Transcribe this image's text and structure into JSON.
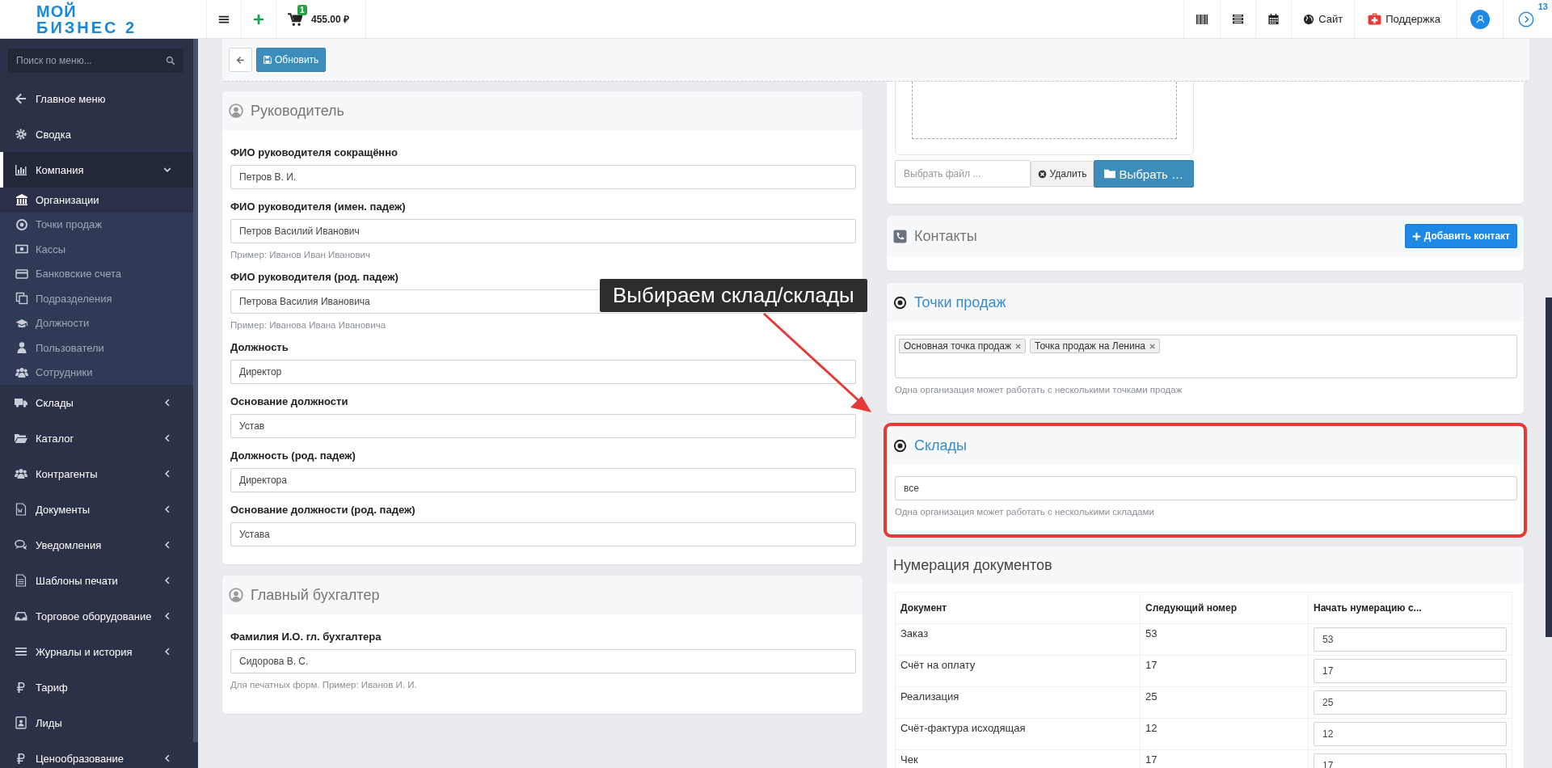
{
  "logo": {
    "line1": "МОЙ",
    "line2": "БИЗНЕС 2"
  },
  "topbar": {
    "cart_badge": "1",
    "cart_total": "455.00 ₽",
    "site": "Сайт",
    "support": "Поддержка",
    "notifications_badge": "13"
  },
  "sidebar": {
    "search_placeholder": "Поиск по меню...",
    "items": [
      {
        "kind": "link",
        "label": "Главное меню",
        "selected": false
      },
      {
        "kind": "link",
        "label": "Сводка",
        "selected": false
      },
      {
        "kind": "group",
        "label": "Компания",
        "selected": true,
        "expanded": true,
        "children": [
          {
            "label": "Организации",
            "selected": true
          },
          {
            "label": "Точки продаж",
            "selected": false
          },
          {
            "label": "Кассы",
            "selected": false
          },
          {
            "label": "Банковские счета",
            "selected": false
          },
          {
            "label": "Подразделения",
            "selected": false
          },
          {
            "label": "Должности",
            "selected": false
          },
          {
            "label": "Пользователи",
            "selected": false
          },
          {
            "label": "Сотрудники",
            "selected": false
          }
        ]
      },
      {
        "kind": "group",
        "label": "Склады",
        "selected": false,
        "expanded": false
      },
      {
        "kind": "group",
        "label": "Каталог",
        "selected": false,
        "expanded": false
      },
      {
        "kind": "group",
        "label": "Контрагенты",
        "selected": false,
        "expanded": false
      },
      {
        "kind": "group",
        "label": "Документы",
        "selected": false,
        "expanded": false
      },
      {
        "kind": "group",
        "label": "Уведомления",
        "selected": false,
        "expanded": false
      },
      {
        "kind": "group",
        "label": "Шаблоны печати",
        "selected": false,
        "expanded": false
      },
      {
        "kind": "group",
        "label": "Торговое оборудование",
        "selected": false,
        "expanded": false
      },
      {
        "kind": "group",
        "label": "Журналы и история",
        "selected": false,
        "expanded": false
      },
      {
        "kind": "link",
        "label": "Тариф",
        "selected": false
      },
      {
        "kind": "link",
        "label": "Лиды",
        "selected": false
      },
      {
        "kind": "group",
        "label": "Ценообразование",
        "selected": false,
        "expanded": false
      }
    ]
  },
  "toolbar": {
    "refresh": "Обновить"
  },
  "manager": {
    "title": "Руководитель",
    "fields": [
      {
        "label": "ФИО руководителя сокращённо",
        "value": "Петров В. И."
      },
      {
        "label": "ФИО руководителя (имен. падеж)",
        "value": "Петров Василий Иванович",
        "hint": "Пример: Иванов Иван Иванович"
      },
      {
        "label": "ФИО руководителя (род. падеж)",
        "value": "Петрова Василия Ивановича",
        "hint": "Пример: Иванова Ивана Ивановича"
      },
      {
        "label": "Должность",
        "value": "Директор"
      },
      {
        "label": "Основание должности",
        "value": "Устав"
      },
      {
        "label": "Должность (род. падеж)",
        "value": "Директора"
      },
      {
        "label": "Основание должности (род. падеж)",
        "value": "Устава"
      }
    ]
  },
  "accountant": {
    "title": "Главный бухгалтер",
    "fields": [
      {
        "label": "Фамилия И.О. гл. бухгалтера",
        "value": "Сидорова В. С.",
        "hint": "Для печатных форм. Пример: Иванов И. И."
      }
    ]
  },
  "file_upload": {
    "placeholder": "Выбрать файл ...",
    "remove": "Удалить",
    "browse": "Выбрать …"
  },
  "contacts": {
    "title": "Контакты",
    "add": "Добавить контакт"
  },
  "sale_points": {
    "title": "Точки продаж",
    "tags": [
      "Основная точка продаж",
      "Точка продаж на Ленина"
    ],
    "hint": "Одна организация может работать с несколькими точками продаж"
  },
  "warehouses": {
    "title": "Склады",
    "highlighted": true,
    "value": "все",
    "hint": "Одна организация может работать с несколькими складами"
  },
  "numbering": {
    "title": "Нумерация документов",
    "columns": [
      "Документ",
      "Следующий номер",
      "Начать нумерацию с..."
    ],
    "rows": [
      {
        "document": "Заказ",
        "next": "53",
        "start": "53"
      },
      {
        "document": "Счёт на оплату",
        "next": "17",
        "start": "17"
      },
      {
        "document": "Реализация",
        "next": "25",
        "start": "25"
      },
      {
        "document": "Счёт-фактура исходящая",
        "next": "12",
        "start": "12"
      },
      {
        "document": "Чек",
        "next": "17",
        "start": "17"
      }
    ]
  },
  "annotation": {
    "text": "Выбираем склад/склады"
  }
}
